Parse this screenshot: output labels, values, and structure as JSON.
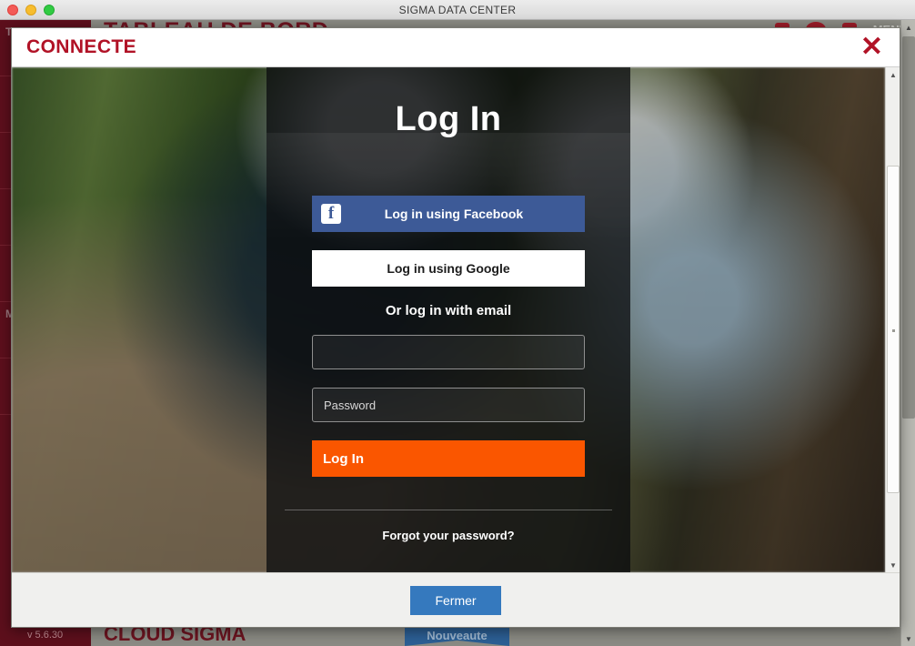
{
  "window": {
    "title": "SIGMA DATA CENTER",
    "traffic_lights": [
      "close",
      "minimize",
      "zoom"
    ]
  },
  "background_page": {
    "header_title": "TABLEAU DE BORD",
    "menu_label": "MENU",
    "version": "v 5.6.30",
    "cloud_label": "CLOUD SIGMA",
    "ribbon_label": "Nouveaute",
    "sidebar_items": [
      {
        "label": "T"
      },
      {
        "label": ""
      },
      {
        "label": ""
      },
      {
        "label": ""
      },
      {
        "label": ""
      },
      {
        "label": "M"
      },
      {
        "label": ""
      }
    ]
  },
  "modal": {
    "title": "CONNECTE",
    "close_icon": "close-icon",
    "footer": {
      "close_label": "Fermer"
    }
  },
  "login": {
    "heading": "Log In",
    "facebook_label": "Log in using Facebook",
    "facebook_icon": "facebook-icon",
    "facebook_icon_glyph": "f",
    "google_label": "Log in using Google",
    "or_label": "Or log in with email",
    "email": {
      "value": "",
      "placeholder": ""
    },
    "password": {
      "value": "",
      "placeholder": "Password"
    },
    "submit_label": "Log In",
    "forgot_label": "Forgot your password?"
  },
  "colors": {
    "brand_red": "#b11226",
    "sidebar_red": "#5d0f1c",
    "facebook_blue": "#3d5a97",
    "login_orange": "#fa5600",
    "fermer_blue": "#3579be"
  }
}
